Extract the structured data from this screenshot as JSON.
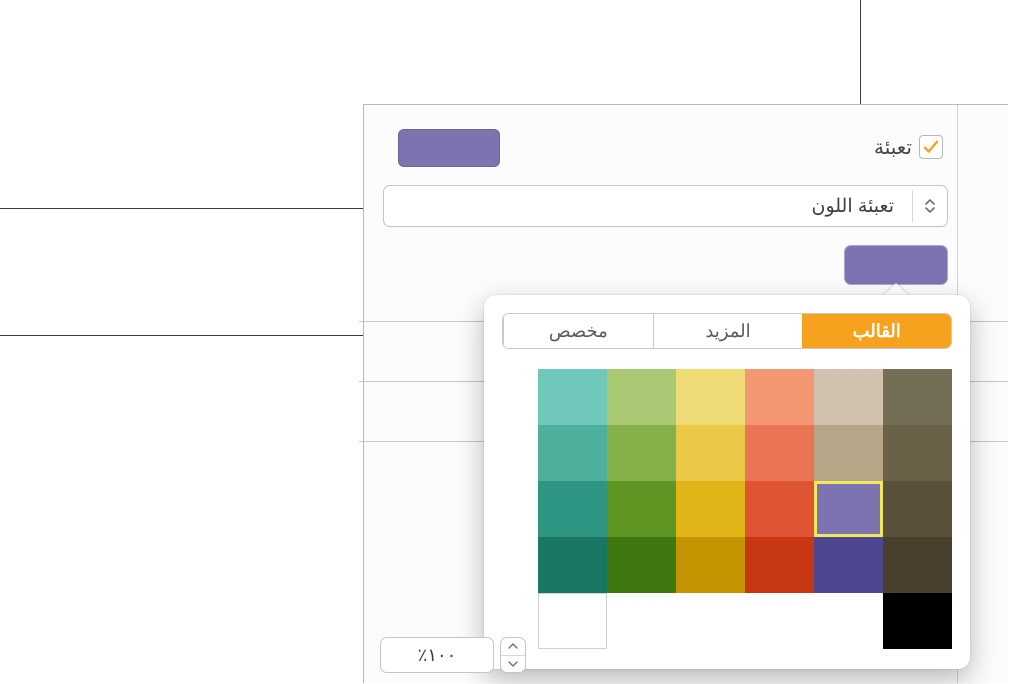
{
  "fill": {
    "checkbox_checked": true,
    "label": "تعبئة",
    "swatch_color": "#7b74b0"
  },
  "fill_type": {
    "selected": "تعبئة اللون"
  },
  "color_well": {
    "color": "#7b74b0"
  },
  "popover": {
    "tabs": {
      "template": "القالب",
      "more": "المزيد",
      "custom": "مخصص",
      "active": "template"
    },
    "palette_rows": [
      [
        "#6fc8b9",
        "#aac975",
        "#efdb76",
        "#f39772",
        "#d0c2ae",
        "#756e57"
      ],
      [
        "#4eb09c",
        "#86b14a",
        "#e9c946",
        "#e97555",
        "#b7a587",
        "#6b6148"
      ],
      [
        "#2d9581",
        "#5e9523",
        "#e1b417",
        "#df5533",
        "#7b74b0",
        "#5a5039"
      ],
      [
        "#1a7763",
        "#3f7710",
        "#c49300",
        "#c73712",
        "#4e4691",
        "#48402c"
      ]
    ],
    "selected_swatch": {
      "row": 2,
      "col": 4
    },
    "bw_row": [
      "#ffffff",
      "",
      "",
      "",
      "",
      "#000000"
    ]
  },
  "opacity": {
    "value": "١٠٠٪"
  }
}
